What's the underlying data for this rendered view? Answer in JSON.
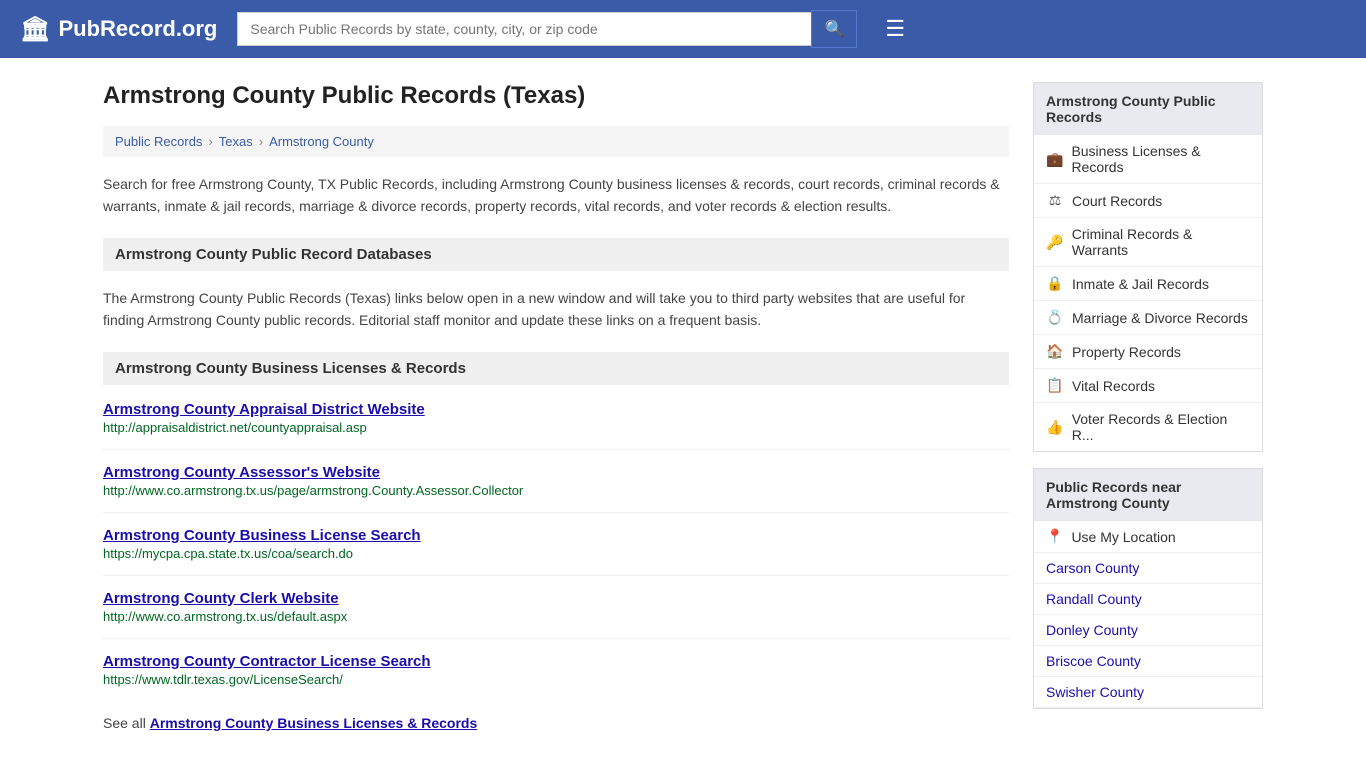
{
  "header": {
    "logo_icon": "🏛",
    "logo_text": "PubRecord.org",
    "search_placeholder": "Search Public Records by state, county, city, or zip code",
    "search_icon": "🔍",
    "menu_icon": "☰"
  },
  "page": {
    "title": "Armstrong County Public Records (Texas)",
    "breadcrumbs": [
      {
        "label": "Public Records",
        "href": "#"
      },
      {
        "label": "Texas",
        "href": "#"
      },
      {
        "label": "Armstrong County",
        "href": "#"
      }
    ],
    "description": "Search for free Armstrong County, TX Public Records, including Armstrong County business licenses & records, court records, criminal records & warrants, inmate & jail records, marriage & divorce records, property records, vital records, and voter records & election results.",
    "databases_section": {
      "header": "Armstrong County Public Record Databases",
      "description": "The Armstrong County Public Records (Texas) links below open in a new window and will take you to third party websites that are useful for finding Armstrong County public records. Editorial staff monitor and update these links on a frequent basis."
    },
    "business_section": {
      "header": "Armstrong County Business Licenses & Records",
      "records": [
        {
          "title": "Armstrong County Appraisal District Website",
          "url": "http://appraisaldistrict.net/countyappraisal.asp"
        },
        {
          "title": "Armstrong County Assessor's Website",
          "url": "http://www.co.armstrong.tx.us/page/armstrong.County.Assessor.Collector"
        },
        {
          "title": "Armstrong County Business License Search",
          "url": "https://mycpa.cpa.state.tx.us/coa/search.do"
        },
        {
          "title": "Armstrong County Clerk Website",
          "url": "http://www.co.armstrong.tx.us/default.aspx"
        },
        {
          "title": "Armstrong County Contractor License Search",
          "url": "https://www.tdlr.texas.gov/LicenseSearch/"
        }
      ],
      "see_all_prefix": "See all ",
      "see_all_link": "Armstrong County Business Licenses & Records"
    }
  },
  "sidebar": {
    "public_records_title": "Armstrong County Public Records",
    "nav_items": [
      {
        "icon": "💼",
        "label": "Business Licenses & Records"
      },
      {
        "icon": "⚖",
        "label": "Court Records"
      },
      {
        "icon": "🔑",
        "label": "Criminal Records & Warrants"
      },
      {
        "icon": "🔒",
        "label": "Inmate & Jail Records"
      },
      {
        "icon": "💍",
        "label": "Marriage & Divorce Records"
      },
      {
        "icon": "🏠",
        "label": "Property Records"
      },
      {
        "icon": "📋",
        "label": "Vital Records"
      },
      {
        "icon": "👍",
        "label": "Voter Records & Election R..."
      }
    ],
    "nearby_title": "Public Records near Armstrong County",
    "use_location_label": "Use My Location",
    "nearby_counties": [
      "Carson County",
      "Randall County",
      "Donley County",
      "Briscoe County",
      "Swisher County"
    ]
  }
}
